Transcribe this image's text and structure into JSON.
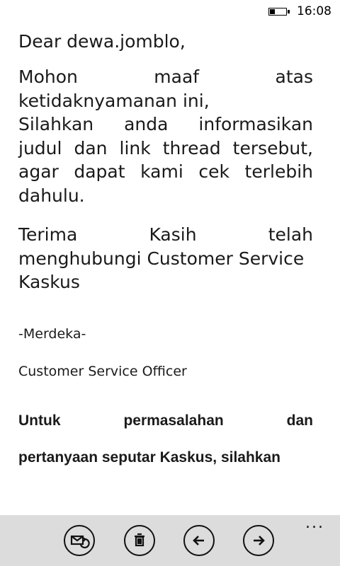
{
  "status_bar": {
    "time": "16:08",
    "battery_level": 0.35
  },
  "email": {
    "greeting": "Dear dewa.jomblo,",
    "para1": [
      "Mohon maaf atas",
      "ketidaknyamanan ini,",
      "Silahkan anda informasikan",
      "judul dan link thread tersebut,",
      "agar dapat kami cek terlebih",
      "dahulu."
    ],
    "para2": [
      "Terima Kasih telah",
      "menghubungi Customer Service",
      "Kaskus"
    ],
    "signature_line1": "-Merdeka-",
    "signature_line2": "Customer Service Officer",
    "bold_note": [
      "Untuk permasalahan dan",
      "pertanyaan seputar Kaskus, silahkan"
    ]
  },
  "appbar": {
    "more": "...",
    "icons": [
      "mark-unread-icon",
      "delete-icon",
      "previous-icon",
      "next-icon"
    ]
  }
}
